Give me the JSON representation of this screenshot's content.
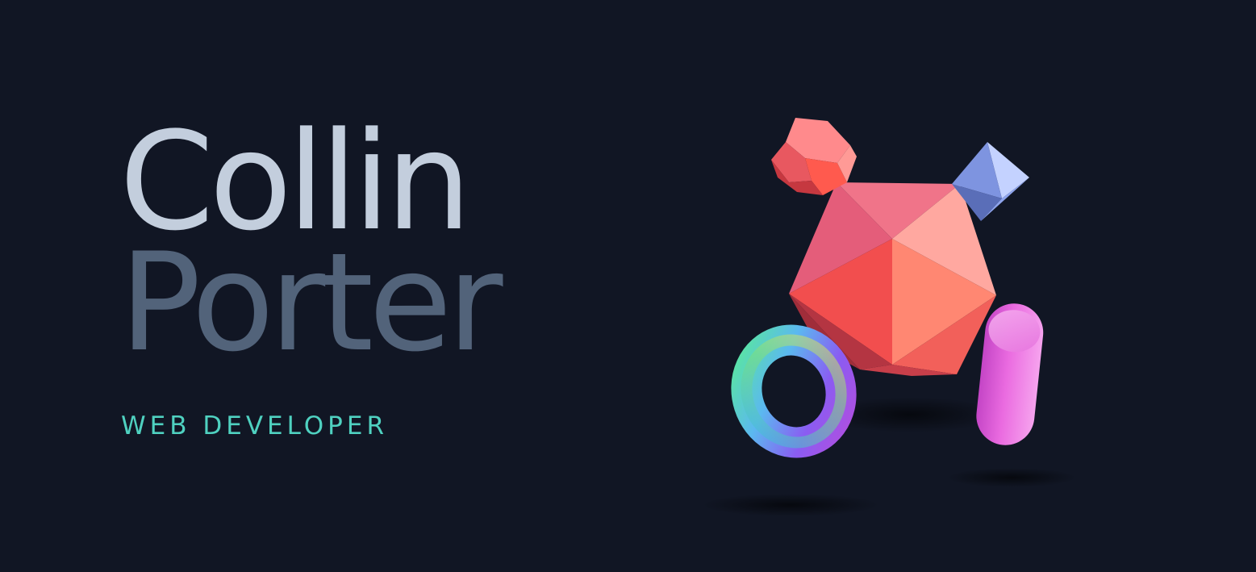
{
  "hero": {
    "first_name": "Collin",
    "last_name": "Porter",
    "role": "WEB DEVELOPER"
  },
  "scene": {
    "objects": [
      "icosahedron",
      "dodecahedron",
      "octahedron",
      "torus",
      "capsule"
    ]
  },
  "colors": {
    "background": "#111624",
    "first_name": "#c3cedd",
    "last_name": "#52637a",
    "role": "#4fd1c0",
    "icosahedron": "#f45a5a",
    "octahedron": "#7f96de",
    "capsule": "#e05bd6"
  }
}
